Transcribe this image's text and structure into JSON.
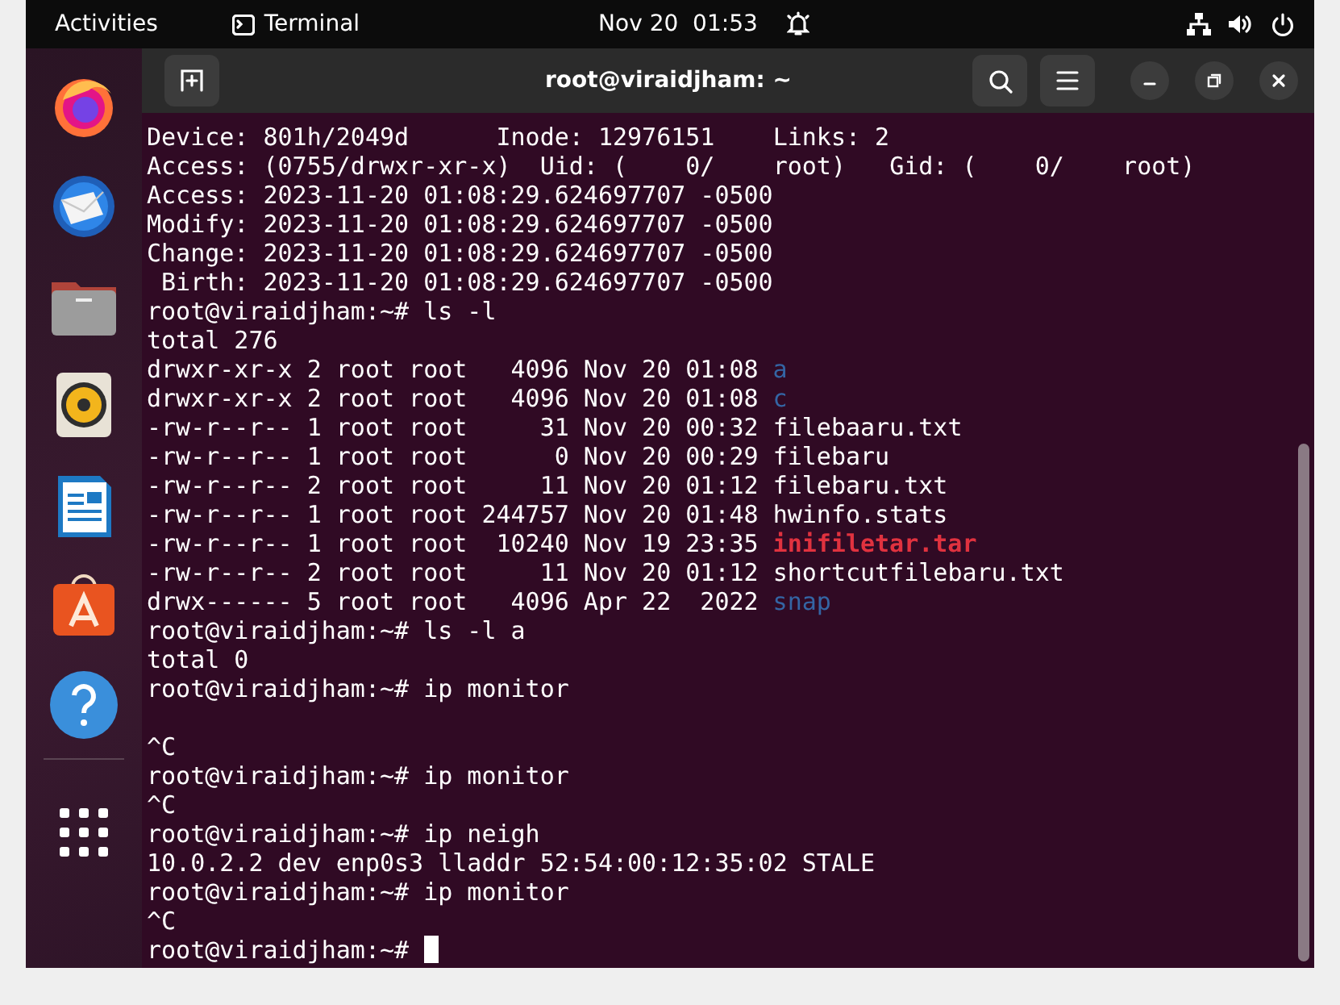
{
  "top_bar": {
    "activities": "Activities",
    "app_name": "Terminal",
    "clock": "Nov 20  01:53"
  },
  "window": {
    "title": "root@viraidjham: ~"
  },
  "terminal": {
    "lines": [
      [
        {
          "kind": "plain",
          "text": "Device: 801h/2049d      Inode: 12976151    Links: 2"
        }
      ],
      [
        {
          "kind": "plain",
          "text": "Access: (0755/drwxr-xr-x)  Uid: (    0/    root)   Gid: (    0/    root)"
        }
      ],
      [
        {
          "kind": "plain",
          "text": "Access: 2023-11-20 01:08:29.624697707 -0500"
        }
      ],
      [
        {
          "kind": "plain",
          "text": "Modify: 2023-11-20 01:08:29.624697707 -0500"
        }
      ],
      [
        {
          "kind": "plain",
          "text": "Change: 2023-11-20 01:08:29.624697707 -0500"
        }
      ],
      [
        {
          "kind": "plain",
          "text": " Birth: 2023-11-20 01:08:29.624697707 -0500"
        }
      ],
      [
        {
          "kind": "plain",
          "text": "root@viraidjham:~# ls -l"
        }
      ],
      [
        {
          "kind": "plain",
          "text": "total 276"
        }
      ],
      [
        {
          "kind": "plain",
          "text": "drwxr-xr-x 2 root root   4096 Nov 20 01:08"
        },
        {
          "kind": "dir",
          "text": "a"
        }
      ],
      [
        {
          "kind": "plain",
          "text": "drwxr-xr-x 2 root root   4096 Nov 20 01:08"
        },
        {
          "kind": "dir",
          "text": "c"
        }
      ],
      [
        {
          "kind": "plain",
          "text": "-rw-r--r-- 1 root root     31 Nov 20 00:32 filebaaru.txt"
        }
      ],
      [
        {
          "kind": "plain",
          "text": "-rw-r--r-- 1 root root      0 Nov 20 00:29 filebaru"
        }
      ],
      [
        {
          "kind": "plain",
          "text": "-rw-r--r-- 2 root root     11 Nov 20 01:12 filebaru.txt"
        }
      ],
      [
        {
          "kind": "plain",
          "text": "-rw-r--r-- 1 root root 244757 Nov 20 01:48 hwinfo.stats"
        }
      ],
      [
        {
          "kind": "plain",
          "text": "-rw-r--r-- 1 root root  10240 Nov 19 23:35"
        },
        {
          "kind": "archive",
          "text": "inifiletar.tar"
        }
      ],
      [
        {
          "kind": "plain",
          "text": "-rw-r--r-- 2 root root     11 Nov 20 01:12 shortcutfilebaru.txt"
        }
      ],
      [
        {
          "kind": "plain",
          "text": "drwx------ 5 root root   4096 Apr 22  2022"
        },
        {
          "kind": "dir",
          "text": "snap"
        }
      ],
      [
        {
          "kind": "plain",
          "text": "root@viraidjham:~# ls -l a"
        }
      ],
      [
        {
          "kind": "plain",
          "text": "total 0"
        }
      ],
      [
        {
          "kind": "plain",
          "text": "root@viraidjham:~# ip monitor"
        }
      ],
      [
        {
          "kind": "blank"
        }
      ],
      [
        {
          "kind": "plain",
          "text": "^C"
        }
      ],
      [
        {
          "kind": "plain",
          "text": "root@viraidjham:~# ip monitor"
        }
      ],
      [
        {
          "kind": "plain",
          "text": "^C"
        }
      ],
      [
        {
          "kind": "plain",
          "text": "root@viraidjham:~# ip neigh"
        }
      ],
      [
        {
          "kind": "plain",
          "text": "10.0.2.2 dev enp0s3 lladdr 52:54:00:12:35:02 STALE"
        }
      ],
      [
        {
          "kind": "plain",
          "text": "root@viraidjham:~# ip monitor"
        }
      ],
      [
        {
          "kind": "plain",
          "text": "^C"
        }
      ],
      [
        {
          "kind": "plain",
          "text": "root@viraidjham:~#"
        },
        {
          "kind": "cursor"
        }
      ]
    ]
  }
}
